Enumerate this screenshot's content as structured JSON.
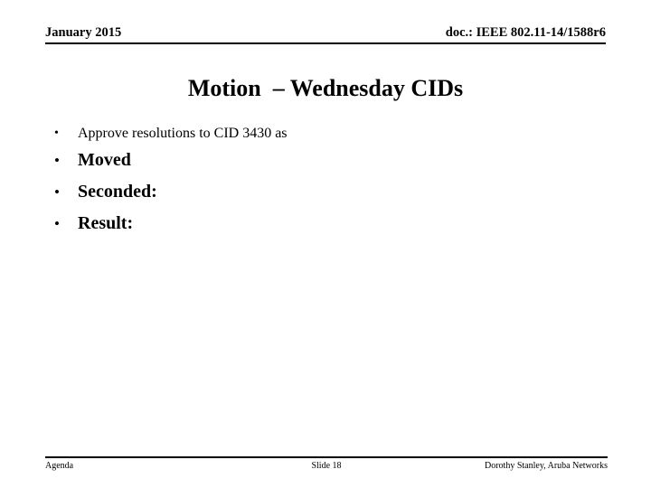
{
  "slide": {
    "background_color": "#ffffff",
    "text_color": "#000000"
  },
  "header": {
    "date": "January 2015",
    "doc_number": "doc.: IEEE 802.11-14/1588r6"
  },
  "title": {
    "text": "Motion  – Wednesday CIDs"
  },
  "body": {
    "intro_bullets": [
      {
        "marker": "•",
        "text": "Approve resolutions to CID 3430 as"
      }
    ],
    "motion_bullets": [
      {
        "marker": "•",
        "text": "Moved"
      },
      {
        "marker": "•",
        "text": "Seconded:"
      },
      {
        "marker": "•",
        "text": "Result:"
      }
    ]
  },
  "footer": {
    "left": "Agenda",
    "center": "Slide 18",
    "right": "Dorothy Stanley, Aruba Networks"
  }
}
